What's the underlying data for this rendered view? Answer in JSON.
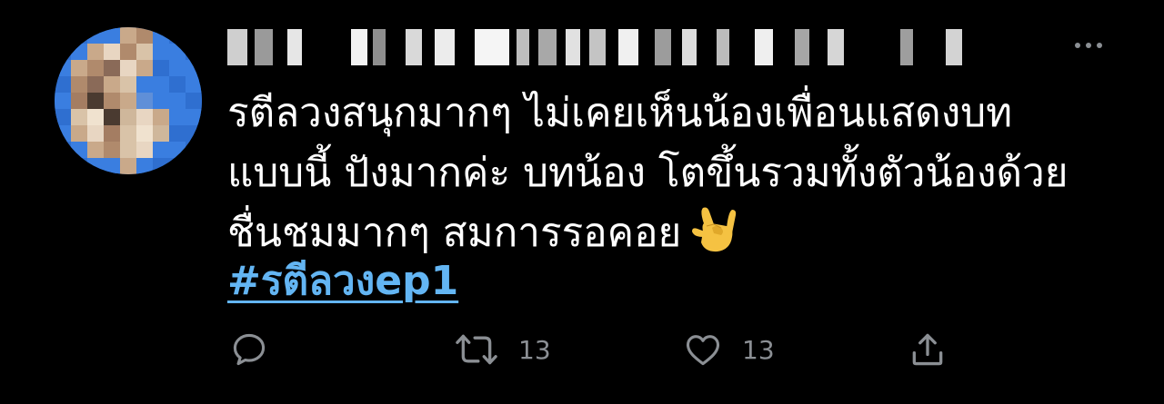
{
  "tweet": {
    "text_lines": [
      "รตีลวงสนุกมากๆ ไม่เคยเห็นน้องเพื่อนแสดงบท",
      "แบบนี้ ปังมากค่ะ บทน้อง โตขึ้นรวมทั้งตัวน้องด้วย",
      "ชื่นชมมากๆ สมการรอคอย"
    ],
    "emoji": "love-you-gesture",
    "hashtag": "#รตีลวงep1"
  },
  "actions": {
    "reply_icon": "reply-icon",
    "retweet_icon": "retweet-icon",
    "retweet_count": "13",
    "like_icon": "heart-icon",
    "like_count": "13",
    "share_icon": "share-icon"
  },
  "colors": {
    "background": "#000000",
    "text": "#ffffff",
    "hashtag": "#63b5f3",
    "icon": "#8b8f94"
  }
}
